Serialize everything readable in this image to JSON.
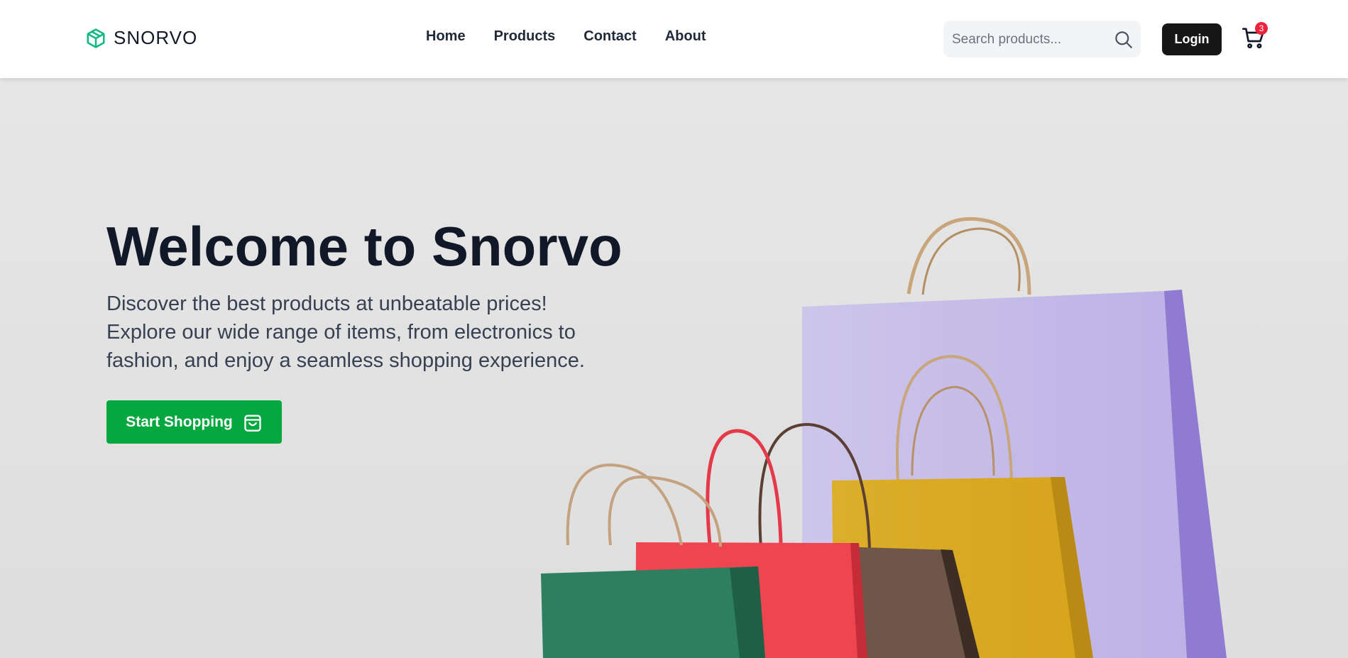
{
  "brand": {
    "name": "SNORVO",
    "icon": "box-icon",
    "accent": "#10b981"
  },
  "nav": {
    "links": [
      "Home",
      "Products",
      "Contact",
      "About"
    ]
  },
  "search": {
    "placeholder": "Search products...",
    "icon": "search-icon"
  },
  "header_actions": {
    "login_label": "Login",
    "cart_count": "3",
    "cart_icon": "cart-icon"
  },
  "hero": {
    "title": "Welcome to Snorvo",
    "description": "Discover the best products at unbeatable prices! Explore our wide range of items, from electronics to fashion, and enjoy a seamless shopping experience.",
    "cta_label": "Start Shopping",
    "cta_icon": "shopping-bag-icon",
    "cta_color": "#05a73f",
    "image": "shopping-bags-photo"
  }
}
